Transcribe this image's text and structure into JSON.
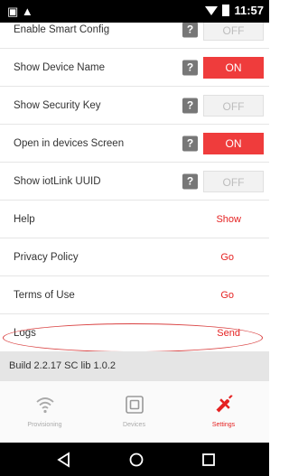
{
  "status": {
    "time": "11:57"
  },
  "settings": [
    {
      "label": "Enable Smart Config",
      "toggle": "OFF",
      "on": false
    },
    {
      "label": "Show Device Name",
      "toggle": "ON",
      "on": true
    },
    {
      "label": "Show Security Key",
      "toggle": "OFF",
      "on": false
    },
    {
      "label": "Open in devices Screen",
      "toggle": "ON",
      "on": true
    },
    {
      "label": "Show iotLink UUID",
      "toggle": "OFF",
      "on": false
    }
  ],
  "help_icon_glyph": "?",
  "links": [
    {
      "label": "Help",
      "action": "Show"
    },
    {
      "label": "Privacy Policy",
      "action": "Go"
    },
    {
      "label": "Terms of Use",
      "action": "Go"
    },
    {
      "label": "Logs",
      "action": "Send"
    }
  ],
  "build": "Build 2.2.17 SC lib 1.0.2",
  "tabs": [
    {
      "label": "Provisioning",
      "icon": "wifi-icon",
      "active": false
    },
    {
      "label": "Devices",
      "icon": "device-icon",
      "active": false
    },
    {
      "label": "Settings",
      "icon": "wrench-icon",
      "active": true
    }
  ],
  "colors": {
    "accent": "#e52222",
    "toggle_on": "#ef3c3c"
  }
}
